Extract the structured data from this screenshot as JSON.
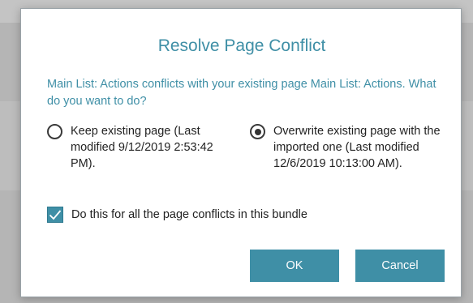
{
  "dialog": {
    "title": "Resolve Page Conflict",
    "message": "Main List: Actions conflicts with your existing page Main List: Actions. What do you want to do?",
    "options": [
      {
        "label": "Keep existing page (Last modified 9/12/2019 2:53:42 PM).",
        "selected": false
      },
      {
        "label": "Overwrite existing page with the imported one (Last modified 12/6/2019 10:13:00 AM).",
        "selected": true
      }
    ],
    "apply_all": {
      "label": "Do this for all the page conflicts in this bundle",
      "checked": true
    },
    "ok_label": "OK",
    "cancel_label": "Cancel"
  },
  "colors": {
    "accent": "#3f8fa6",
    "text": "#222222",
    "backdrop": "#b5b5b5"
  },
  "icons": {
    "radio_unselected": "radio-unselected-icon",
    "radio_selected": "radio-selected-icon",
    "checkbox_checked": "checkmark-icon"
  }
}
